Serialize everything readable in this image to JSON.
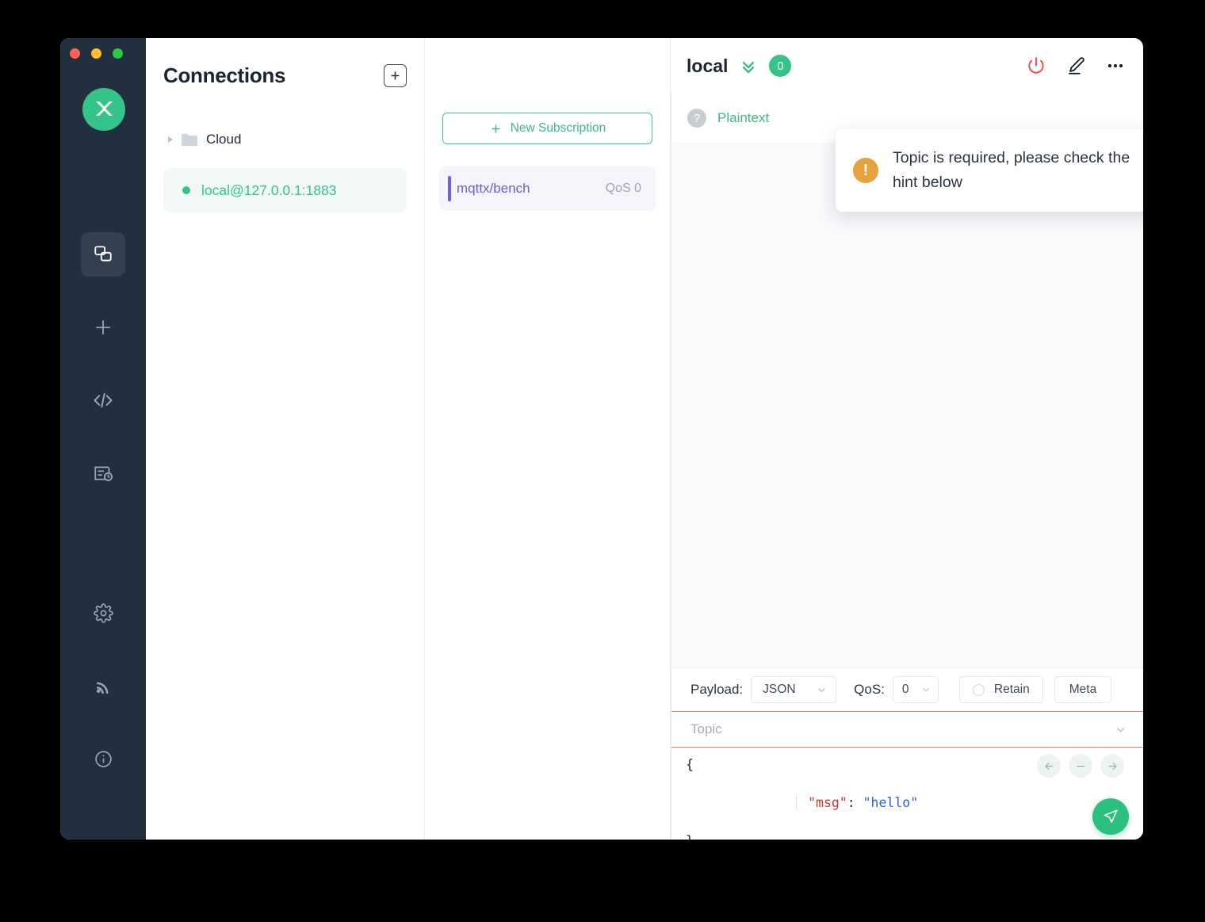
{
  "window": {
    "traffic_lights": [
      "close",
      "minimize",
      "maximize"
    ],
    "logo_name": "mqttx-logo"
  },
  "rail": {
    "items": [
      {
        "name": "connections",
        "icon": "windows-copy-icon",
        "active": true
      },
      {
        "name": "new-connection",
        "icon": "plus-icon",
        "active": false
      },
      {
        "name": "scripts",
        "icon": "code-icon",
        "active": false
      },
      {
        "name": "log",
        "icon": "log-history-icon",
        "active": false
      },
      {
        "name": "settings",
        "icon": "gear-icon",
        "active": false
      },
      {
        "name": "broadcast",
        "icon": "broadcast-icon",
        "active": false
      },
      {
        "name": "about",
        "icon": "info-icon",
        "active": false
      }
    ]
  },
  "connections": {
    "title": "Connections",
    "add_label": "+",
    "folder": {
      "label": "Cloud",
      "expanded": false
    },
    "items": [
      {
        "label": "local@127.0.0.1:1883",
        "status": "connected",
        "selected": true
      }
    ]
  },
  "subscriptions": {
    "new_button": "New Subscription",
    "new_button_icon": "+",
    "items": [
      {
        "topic": "mqttx/bench",
        "qos": "QoS 0",
        "color": "#6e5fe0"
      }
    ]
  },
  "main": {
    "connection_name": "local",
    "message_count": "0",
    "actions": [
      {
        "name": "disconnect",
        "icon": "power-icon",
        "color": "#ef4444"
      },
      {
        "name": "edit-connection",
        "icon": "pencil-icon",
        "color": "#1f2937"
      },
      {
        "name": "more-options",
        "icon": "ellipsis-icon",
        "color": "#1f2937"
      }
    ],
    "format_help_icon": "?",
    "format_label": "Plaintext"
  },
  "publish": {
    "payload_label": "Payload:",
    "payload_format": "JSON",
    "qos_label": "QoS:",
    "qos_value": "0",
    "retain_label": "Retain",
    "retain_checked": false,
    "meta_label": "Meta",
    "topic_value": "",
    "topic_placeholder": "Topic",
    "topic_error": true,
    "editor": {
      "line1": "{",
      "line2_key": "\"msg\"",
      "line2_colon": ": ",
      "line2_value": "\"hello\"",
      "line3": "}"
    },
    "nav_buttons": [
      {
        "name": "prev-message",
        "icon": "arrow-left-icon"
      },
      {
        "name": "clear-message",
        "icon": "minus-icon"
      },
      {
        "name": "next-message",
        "icon": "arrow-right-icon"
      }
    ],
    "send_icon": "send-plane-icon"
  },
  "toast": {
    "icon": "!",
    "message": "Topic is required, please check the hint below",
    "close_icon": "×",
    "type": "warning",
    "accent_color": "#e6a23c"
  }
}
